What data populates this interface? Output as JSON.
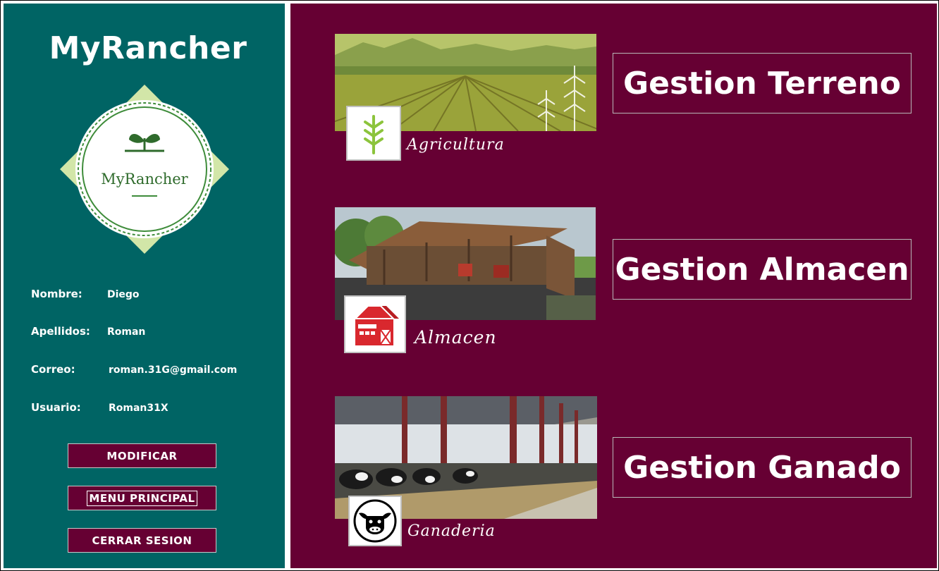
{
  "sidebar": {
    "app_title": "MyRancher",
    "logo_text": "MyRancher",
    "user": {
      "name_label": "Nombre:",
      "name_value": "Diego",
      "surname_label": "Apellidos:",
      "surname_value": "Roman",
      "email_label": "Correo:",
      "email_value": "roman.31G@gmail.com",
      "username_label": "Usuario:",
      "username_value": "Roman31X"
    },
    "buttons": {
      "modify": "MODIFICAR",
      "main_menu": "MENU PRINCIPAL",
      "logout": "CERRAR SESION"
    }
  },
  "main": {
    "cards": [
      {
        "caption": "Agricultura",
        "icon": "wheat-icon",
        "button": "Gestion Terreno"
      },
      {
        "caption": "Almacen",
        "icon": "barn-icon",
        "button": "Gestion Almacen"
      },
      {
        "caption": "Ganaderia",
        "icon": "cow-head-icon",
        "button": "Gestion Ganado"
      }
    ]
  },
  "colors": {
    "sidebar_bg": "#006464",
    "main_bg": "#660033",
    "button_bg": "#660033",
    "logo_green": "#3e8c3a",
    "logo_diamond": "#d2e6a8"
  }
}
